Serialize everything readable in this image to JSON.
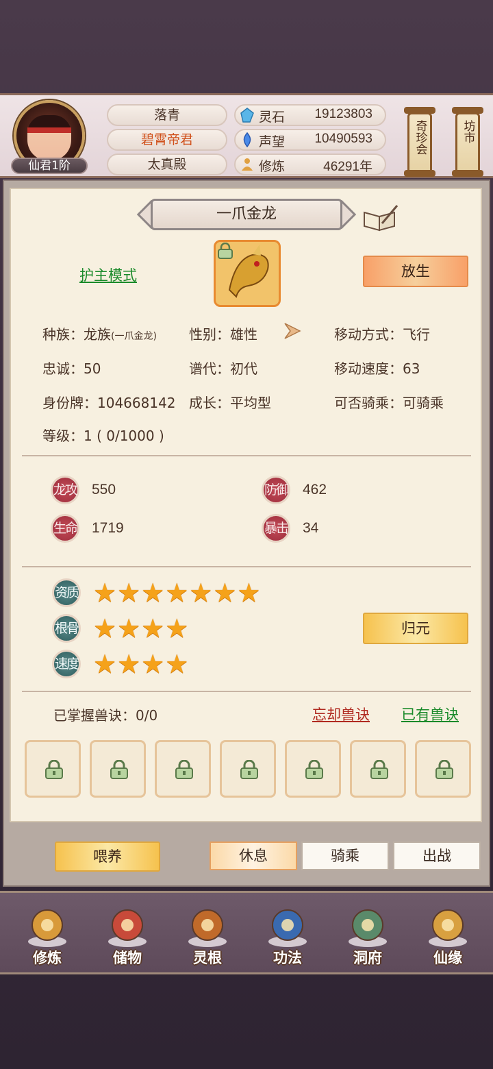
{
  "player": {
    "rank_badge": "仙君1阶",
    "names": [
      "落青",
      "碧霄帝君",
      "太真殿"
    ]
  },
  "resources": [
    {
      "label": "灵石",
      "value": "19123803",
      "icon": "spirit-stone-icon"
    },
    {
      "label": "声望",
      "value": "10490593",
      "icon": "reputation-flame-icon"
    },
    {
      "label": "修炼",
      "value": "46291年",
      "icon": "meditation-icon"
    }
  ],
  "side_buttons": {
    "treasure": "奇珍会",
    "market": "坊市"
  },
  "pet": {
    "name": "一爪金龙",
    "guard_mode": "护主模式",
    "release_btn": "放生",
    "info": {
      "race_label": "种族：",
      "race": "龙族",
      "race_sub": "(一爪金龙)",
      "gender_label": "性别：",
      "gender": "雄性",
      "move_mode_label": "移动方式：",
      "move_mode": "飞行",
      "loyalty_label": "忠诚：",
      "loyalty": "50",
      "generation_label": "谱代：",
      "generation": "初代",
      "move_speed_label": "移动速度：",
      "move_speed": "63",
      "id_label": "身份牌：",
      "id": "104668142",
      "growth_label": "成长：",
      "growth": "平均型",
      "rideable_label": "可否骑乘：",
      "rideable": "可骑乘",
      "level_label": "等级：",
      "level": "1 ( 0/1000 )"
    },
    "stats": [
      {
        "label": "龙攻",
        "value": "550"
      },
      {
        "label": "防御",
        "value": "462"
      },
      {
        "label": "生命",
        "value": "1719"
      },
      {
        "label": "暴击",
        "value": "34"
      }
    ],
    "aptitudes": [
      {
        "label": "资质",
        "stars": 7,
        "star_text": "★★★★★★★"
      },
      {
        "label": "根骨",
        "stars": 4,
        "star_text": "★★★★"
      },
      {
        "label": "速度",
        "stars": 4,
        "star_text": "★★★★"
      }
    ],
    "return_btn": "归元",
    "skills": {
      "mastered": "已掌握兽诀：0/0",
      "forget": "忘却兽诀",
      "owned": "已有兽诀",
      "slots": 7
    }
  },
  "actions": {
    "feed": "喂养",
    "rest": "休息",
    "ride": "骑乘",
    "battle": "出战"
  },
  "nav": [
    {
      "label": "修炼",
      "icon": "cultivation-monk-icon"
    },
    {
      "label": "储物",
      "icon": "storage-bag-icon"
    },
    {
      "label": "灵根",
      "icon": "spirit-root-icon"
    },
    {
      "label": "功法",
      "icon": "technique-book-icon"
    },
    {
      "label": "洞府",
      "icon": "cave-mansion-icon"
    },
    {
      "label": "仙缘",
      "icon": "immortal-gourd-icon"
    }
  ],
  "colors": {
    "accent_orange": "#f8a068",
    "accent_gold": "#f6c24e",
    "link_green": "#1a8a2a",
    "link_red": "#b02a20",
    "star": "#f5a21a"
  }
}
